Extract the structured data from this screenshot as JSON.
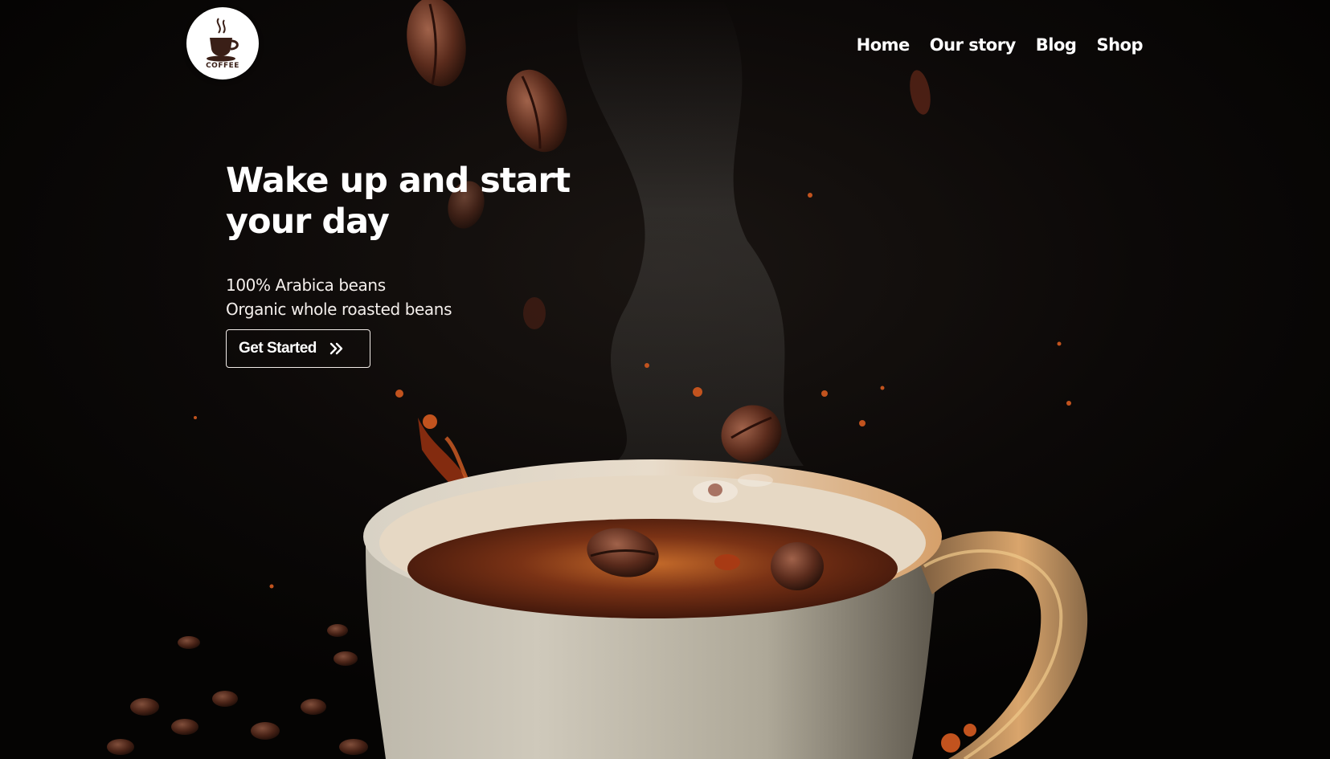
{
  "brand": {
    "logo_text": "COFFEE",
    "logo_icon": "coffee-cup-icon"
  },
  "nav": {
    "items": [
      {
        "label": "Home"
      },
      {
        "label": "Our story"
      },
      {
        "label": "Blog"
      },
      {
        "label": "Shop"
      }
    ]
  },
  "hero": {
    "headline": "Wake up and start your day",
    "features": [
      "100% Arabica beans",
      "Organic whole roasted beans"
    ],
    "cta_label": "Get Started",
    "cta_icon": "double-chevron-right-icon"
  },
  "colors": {
    "background": "#070504",
    "text": "#ffffff",
    "logo_brown": "#3a1f17"
  }
}
